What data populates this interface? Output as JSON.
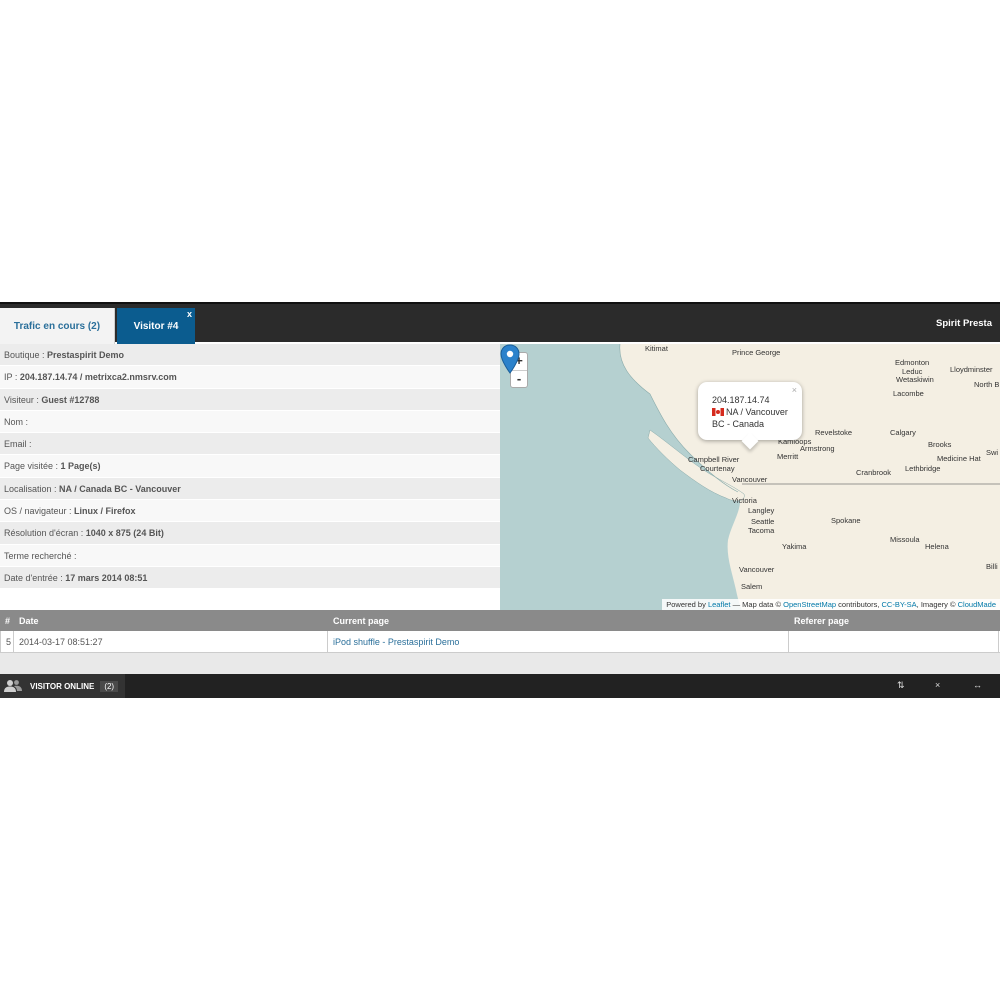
{
  "tabs": {
    "traffic_label": "Trafic en cours (2)",
    "visitor_label": "Visitor #4",
    "visitor_close": "x"
  },
  "brand": "Spirit Presta",
  "info_rows": [
    {
      "label": "Boutique : ",
      "value": "Prestaspirit Demo"
    },
    {
      "label": "IP : ",
      "value": "204.187.14.74 / metrixca2.nmsrv.com"
    },
    {
      "label": "Visiteur : ",
      "value": "Guest #12788"
    },
    {
      "label": "Nom : ",
      "value": ""
    },
    {
      "label": "Email : ",
      "value": ""
    },
    {
      "label": "Page visitée : ",
      "value": "1 Page(s)"
    },
    {
      "label": "Localisation : ",
      "value": "NA / Canada BC - Vancouver"
    },
    {
      "label": "OS / navigateur : ",
      "value": "Linux / Firefox"
    },
    {
      "label": "Résolution d'écran : ",
      "value": "1040 x 875 (24 Bit)"
    },
    {
      "label": "Terme recherché : ",
      "value": ""
    },
    {
      "label": "Date d'entrée : ",
      "value": "17 mars 2014 08:51"
    }
  ],
  "map": {
    "zoom_in": "+",
    "zoom_out": "-",
    "popup": {
      "ip": "204.187.14.74",
      "line2": "NA / Vancouver",
      "line3": "BC - Canada",
      "close": "×"
    },
    "places": {
      "kitimat": "Kitimat",
      "prince_george": "Prince George",
      "edmonton": "Edmonton",
      "leduc": "Leduc",
      "wetaskiwin": "Wetaskiwin",
      "lloydminster": "Lloydminster",
      "north_b": "North B",
      "lacombe": "Lacombe",
      "revelstoke": "Revelstoke",
      "calgary": "Calgary",
      "kamloops": "Kamloops",
      "armstrong": "Armstrong",
      "brooks": "Brooks",
      "swi": "Swi",
      "campbell_river": "Campbell River",
      "courtenay": "Courtenay",
      "merritt": "Merritt",
      "medicine_hat": "Medicine Hat",
      "lethbridge": "Lethbridge",
      "cranbrook": "Cranbrook",
      "vancouver": "Vancouver",
      "victoria": "Victoria",
      "langley": "Langley",
      "seattle": "Seattle",
      "tacoma": "Tacoma",
      "spokane": "Spokane",
      "yakima": "Yakima",
      "missoula": "Missoula",
      "helena": "Helena",
      "billi": "Billi",
      "vancouver_wa": "Vancouver",
      "salem": "Salem"
    },
    "attribution": {
      "p1": "Powered by ",
      "leaflet": "Leaflet",
      "p2": " — Map data © ",
      "osm": "OpenStreetMap",
      "p3": " contributors, ",
      "ccbysa": "CC-BY-SA",
      "p4": ", Imagery © ",
      "cloudmade": "CloudMade"
    }
  },
  "table": {
    "headers": [
      "#",
      "Date",
      "Current page",
      "Referer page"
    ],
    "rows": [
      {
        "num": "5",
        "date": "2014-03-17 08:51:27",
        "page": "iPod shuffle - Prestaspirit Demo",
        "referer": ""
      }
    ]
  },
  "bottom": {
    "label": "VISITOR ONLINE",
    "count": "(2)",
    "ctrl1": "⇅",
    "ctrl2": "×",
    "ctrl3": "↔"
  },
  "colors": {
    "tab_active": "#0b5c8f",
    "bar_dark": "#2b2b2b",
    "link": "#2a6f9a",
    "marker": "#2b82cb",
    "water": "#b5d0d0"
  }
}
